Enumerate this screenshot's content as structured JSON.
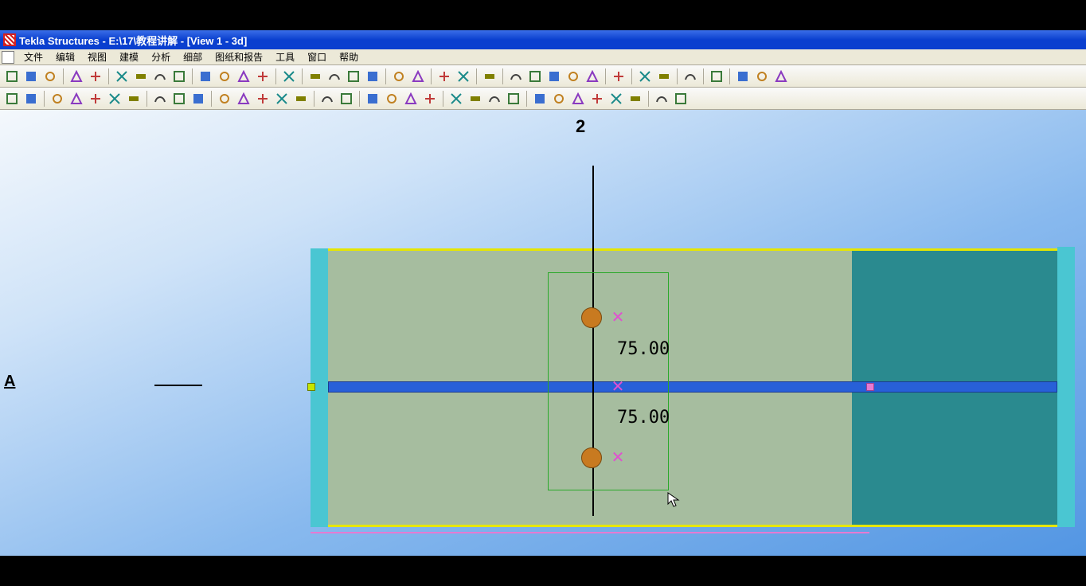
{
  "title": "Tekla Structures - E:\\17\\教程讲解 - [View 1 - 3d]",
  "menu": {
    "items": [
      "文件",
      "编辑",
      "视图",
      "建模",
      "分析",
      "细部",
      "图纸和报告",
      "工具",
      "窗口",
      "帮助"
    ]
  },
  "viewport": {
    "grid_top_label": "2",
    "grid_left_label": "A",
    "dimension_1": "75.00",
    "dimension_2": "75.00"
  },
  "toolbar1_icons": [
    "new-file",
    "open-file",
    "save-file",
    "undo",
    "redo",
    "copy",
    "paste",
    "print",
    "properties",
    "window-1",
    "window-2",
    "window-3",
    "cut",
    "clip-yellow",
    "box-1",
    "box-2",
    "box-3",
    "box-4",
    "probe-1",
    "probe-2",
    "link-1",
    "link-2",
    "help",
    "grid-1",
    "grid-2",
    "grid-3",
    "grid-4",
    "grid-5",
    "zoom",
    "multi-1",
    "multi-2",
    "swap",
    "tekla-red",
    "run",
    "misc-1",
    "misc-2"
  ],
  "toolbar2_icons": [
    "part-1",
    "part-2",
    "profile-1",
    "profile-2",
    "profile-3",
    "profile-4",
    "profile-5",
    "weld-1",
    "weld-2",
    "weld-3",
    "beam-1",
    "beam-2",
    "beam-3",
    "beam-4",
    "beam-5",
    "bolt-1",
    "bolt-2",
    "find",
    "filter-1",
    "filter-2",
    "book",
    "snap-1",
    "snap-2",
    "snap-3",
    "snap-4",
    "sline-1",
    "sline-2",
    "sline-3",
    "sline-4",
    "sline-5",
    "sline-6",
    "pt-1",
    "pt-2"
  ]
}
